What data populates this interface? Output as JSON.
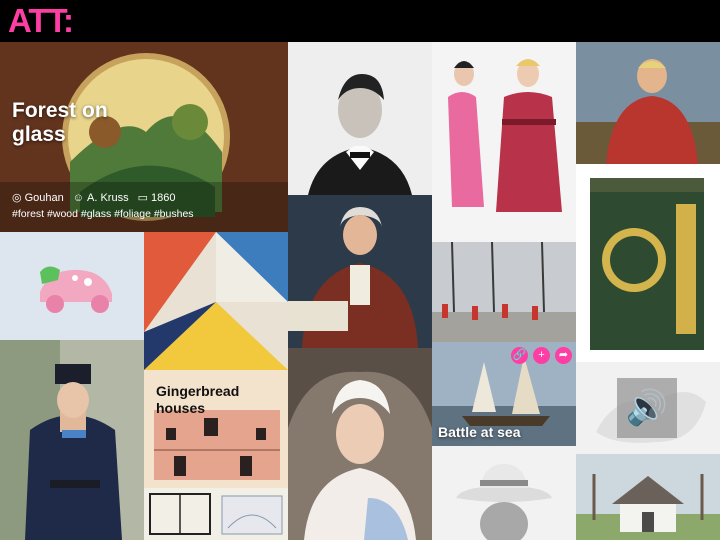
{
  "header": {
    "logo": "ATT:"
  },
  "featured": {
    "title": "Forest on glass",
    "place": "Gouhan",
    "author": "A. Kruss",
    "year": "1860",
    "tags": "#forest #wood #glass #foliage #bushes",
    "place_icon": "pin-icon",
    "author_icon": "user-icon",
    "year_icon": "calendar-icon"
  },
  "tiles": {
    "gingerbread": {
      "title": "Gingerbread houses"
    },
    "sea": {
      "title": "Battle at sea"
    }
  },
  "actions": {
    "link": "🔗",
    "add": "+",
    "share": "➦"
  },
  "audio": {
    "icon": "🔊"
  },
  "colors": {
    "accent": "#ff3ea5",
    "background": "#000000"
  }
}
